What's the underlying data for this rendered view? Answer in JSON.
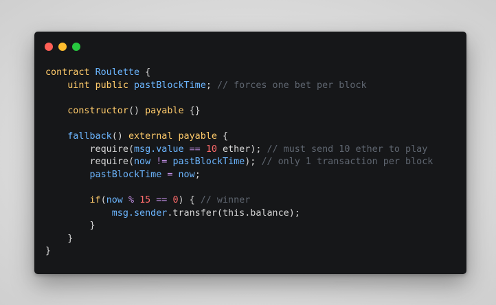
{
  "window": {
    "controls": [
      "close",
      "minimize",
      "zoom"
    ]
  },
  "code": {
    "language": "solidity",
    "lines": [
      [
        {
          "t": "contract",
          "k": "kw"
        },
        {
          "t": " ",
          "k": "pl"
        },
        {
          "t": "Roulette",
          "k": "ty"
        },
        {
          "t": " {",
          "k": "pl"
        }
      ],
      [
        {
          "t": "    ",
          "k": "pl"
        },
        {
          "t": "uint",
          "k": "kw"
        },
        {
          "t": " ",
          "k": "pl"
        },
        {
          "t": "public",
          "k": "kw"
        },
        {
          "t": " ",
          "k": "pl"
        },
        {
          "t": "pastBlockTime",
          "k": "var"
        },
        {
          "t": "; ",
          "k": "pl"
        },
        {
          "t": "// forces one bet per block",
          "k": "cm"
        }
      ],
      [],
      [
        {
          "t": "    ",
          "k": "pl"
        },
        {
          "t": "constructor",
          "k": "kw"
        },
        {
          "t": "() ",
          "k": "pl"
        },
        {
          "t": "payable",
          "k": "kw"
        },
        {
          "t": " {}",
          "k": "pl"
        }
      ],
      [],
      [
        {
          "t": "    ",
          "k": "pl"
        },
        {
          "t": "fallback",
          "k": "var"
        },
        {
          "t": "() ",
          "k": "pl"
        },
        {
          "t": "external",
          "k": "kw"
        },
        {
          "t": " ",
          "k": "pl"
        },
        {
          "t": "payable",
          "k": "kw"
        },
        {
          "t": " {",
          "k": "pl"
        }
      ],
      [
        {
          "t": "        ",
          "k": "pl"
        },
        {
          "t": "require",
          "k": "pl"
        },
        {
          "t": "(",
          "k": "pl"
        },
        {
          "t": "msg.value",
          "k": "var"
        },
        {
          "t": " ",
          "k": "pl"
        },
        {
          "t": "==",
          "k": "op"
        },
        {
          "t": " ",
          "k": "pl"
        },
        {
          "t": "10",
          "k": "num"
        },
        {
          "t": " ether); ",
          "k": "pl"
        },
        {
          "t": "// must send 10 ether to play",
          "k": "cm"
        }
      ],
      [
        {
          "t": "        ",
          "k": "pl"
        },
        {
          "t": "require",
          "k": "pl"
        },
        {
          "t": "(",
          "k": "pl"
        },
        {
          "t": "now",
          "k": "var"
        },
        {
          "t": " ",
          "k": "pl"
        },
        {
          "t": "!=",
          "k": "op"
        },
        {
          "t": " ",
          "k": "pl"
        },
        {
          "t": "pastBlockTime",
          "k": "var"
        },
        {
          "t": "); ",
          "k": "pl"
        },
        {
          "t": "// only 1 transaction per block",
          "k": "cm"
        }
      ],
      [
        {
          "t": "        ",
          "k": "pl"
        },
        {
          "t": "pastBlockTime",
          "k": "var"
        },
        {
          "t": " ",
          "k": "pl"
        },
        {
          "t": "=",
          "k": "op"
        },
        {
          "t": " ",
          "k": "pl"
        },
        {
          "t": "now",
          "k": "var"
        },
        {
          "t": ";",
          "k": "pl"
        }
      ],
      [],
      [
        {
          "t": "        ",
          "k": "pl"
        },
        {
          "t": "if",
          "k": "kw"
        },
        {
          "t": "(",
          "k": "pl"
        },
        {
          "t": "now",
          "k": "var"
        },
        {
          "t": " ",
          "k": "pl"
        },
        {
          "t": "%",
          "k": "op"
        },
        {
          "t": " ",
          "k": "pl"
        },
        {
          "t": "15",
          "k": "num"
        },
        {
          "t": " ",
          "k": "pl"
        },
        {
          "t": "==",
          "k": "op"
        },
        {
          "t": " ",
          "k": "pl"
        },
        {
          "t": "0",
          "k": "num"
        },
        {
          "t": ") { ",
          "k": "pl"
        },
        {
          "t": "// winner",
          "k": "cm"
        }
      ],
      [
        {
          "t": "            ",
          "k": "pl"
        },
        {
          "t": "msg.sender",
          "k": "var"
        },
        {
          "t": ".transfer(this.balance);",
          "k": "pl"
        }
      ],
      [
        {
          "t": "        }",
          "k": "pl"
        }
      ],
      [
        {
          "t": "    }",
          "k": "pl"
        }
      ],
      [
        {
          "t": "}",
          "k": "pl"
        }
      ]
    ]
  },
  "colors": {
    "background": "#161719",
    "keyword": "#ffcb6b",
    "identifier": "#6cb6ff",
    "number": "#ff6b6b",
    "operator": "#c792ea",
    "comment": "#5f6670",
    "plain": "#d7d7d7",
    "close": "#ff5f56",
    "minimize": "#ffbd2e",
    "zoom": "#27c93f"
  }
}
